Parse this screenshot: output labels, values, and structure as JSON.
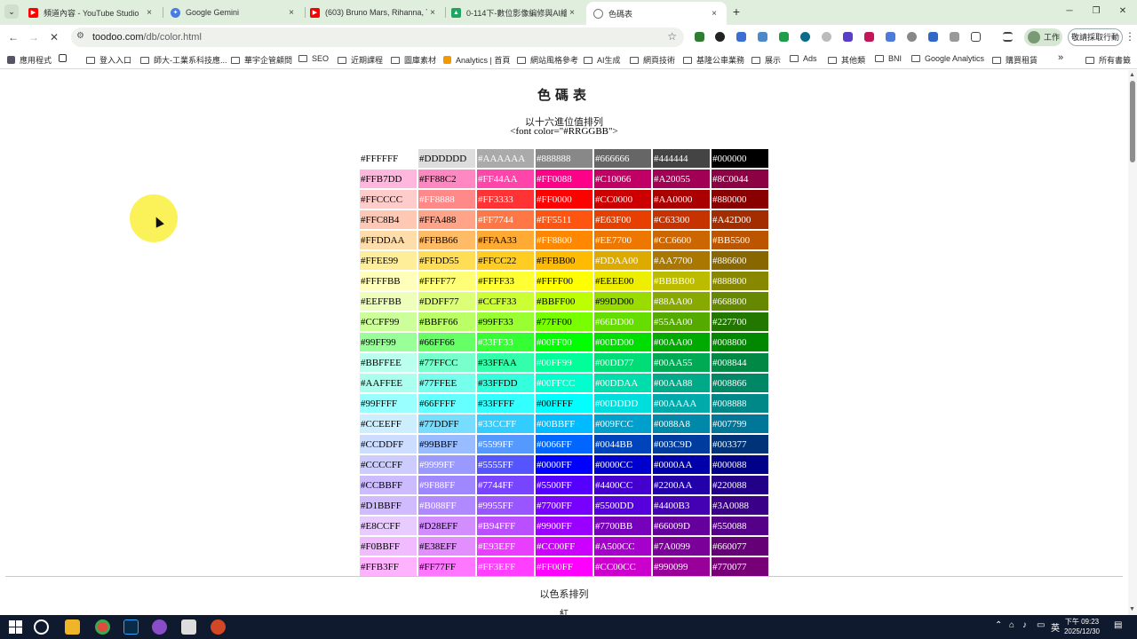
{
  "browser": {
    "tabs": [
      {
        "title": "頻道內容 - YouTube Studio",
        "icon": "youtube-icon",
        "color": "#ff0000",
        "active": false
      },
      {
        "title": "Google Gemini",
        "icon": "gemini-icon",
        "color": "#4a7be0",
        "active": false
      },
      {
        "title": "(603) Bruno Mars, Rihanna, Th",
        "icon": "youtube-icon",
        "color": "#ff0000",
        "active": false
      },
      {
        "title": "0-114下-數位影像編修與AI繪",
        "icon": "drive-icon",
        "color": "#1fa463",
        "active": false
      },
      {
        "title": "色碼表",
        "icon": "globe-icon",
        "color": "#777777",
        "active": true
      }
    ],
    "tab_close_glyph": "×",
    "new_tab_glyph": "+",
    "url_domain": "toodoo.com",
    "url_path": "/db/color.html",
    "profile_label": "工作",
    "action_label": "敬請採取行動",
    "bookmarks": [
      {
        "label": "應用程式",
        "icon": "apps-grid-icon"
      },
      {
        "label": "",
        "icon": "grid-icon"
      },
      {
        "label": "登入入口",
        "icon": "folder-icon"
      },
      {
        "label": "師大-工業系科技應...",
        "icon": "folder-icon"
      },
      {
        "label": "華宇企管顧問",
        "icon": "folder-icon"
      },
      {
        "label": "SEO",
        "icon": "folder-icon"
      },
      {
        "label": "近期課程",
        "icon": "folder-icon"
      },
      {
        "label": "圖庫素材",
        "icon": "folder-icon"
      },
      {
        "label": "Analytics | 首頁",
        "icon": "analytics-icon"
      },
      {
        "label": "網站風格參考",
        "icon": "folder-icon"
      },
      {
        "label": "AI生成",
        "icon": "folder-icon"
      },
      {
        "label": "網頁技術",
        "icon": "folder-icon"
      },
      {
        "label": "基隆公車業務",
        "icon": "folder-icon"
      },
      {
        "label": "展示",
        "icon": "folder-icon"
      },
      {
        "label": "Ads",
        "icon": "folder-icon"
      },
      {
        "label": "其他類",
        "icon": "folder-icon"
      },
      {
        "label": "BNI",
        "icon": "folder-icon"
      },
      {
        "label": "Google Analytics",
        "icon": "folder-icon"
      },
      {
        "label": "購買租賃",
        "icon": "folder-icon"
      }
    ],
    "bookmarks_more": "»",
    "all_bookmarks": "所有書籤"
  },
  "page": {
    "title": "色碼表",
    "subtitle": "以十六進位值排列",
    "code_hint": "<font color=\"#RRGGBB\">",
    "section2_label": "以色系排列",
    "section3_label": "紅"
  },
  "color_table": [
    [
      "#FFFFFF",
      "#DDDDDD",
      "#AAAAAA",
      "#888888",
      "#666666",
      "#444444",
      "#000000"
    ],
    [
      "#FFB7DD",
      "#FF88C2",
      "#FF44AA",
      "#FF0088",
      "#C10066",
      "#A20055",
      "#8C0044"
    ],
    [
      "#FFCCCC",
      "#FF8888",
      "#FF3333",
      "#FF0000",
      "#CC0000",
      "#AA0000",
      "#880000"
    ],
    [
      "#FFC8B4",
      "#FFA488",
      "#FF7744",
      "#FF5511",
      "#E63F00",
      "#C63300",
      "#A42D00"
    ],
    [
      "#FFDDAA",
      "#FFBB66",
      "#FFAA33",
      "#FF8800",
      "#EE7700",
      "#CC6600",
      "#BB5500"
    ],
    [
      "#FFEE99",
      "#FFDD55",
      "#FFCC22",
      "#FFBB00",
      "#DDAA00",
      "#AA7700",
      "#886600"
    ],
    [
      "#FFFFBB",
      "#FFFF77",
      "#FFFF33",
      "#FFFF00",
      "#EEEE00",
      "#BBBB00",
      "#888800"
    ],
    [
      "#EEFFBB",
      "#DDFF77",
      "#CCFF33",
      "#BBFF00",
      "#99DD00",
      "#88AA00",
      "#668800"
    ],
    [
      "#CCFF99",
      "#BBFF66",
      "#99FF33",
      "#77FF00",
      "#66DD00",
      "#55AA00",
      "#227700"
    ],
    [
      "#99FF99",
      "#66FF66",
      "#33FF33",
      "#00FF00",
      "#00DD00",
      "#00AA00",
      "#008800"
    ],
    [
      "#BBFFEE",
      "#77FFCC",
      "#33FFAA",
      "#00FF99",
      "#00DD77",
      "#00AA55",
      "#008844"
    ],
    [
      "#AAFFEE",
      "#77FFEE",
      "#33FFDD",
      "#00FFCC",
      "#00DDAA",
      "#00AA88",
      "#008866"
    ],
    [
      "#99FFFF",
      "#66FFFF",
      "#33FFFF",
      "#00FFFF",
      "#00DDDD",
      "#00AAAA",
      "#008888"
    ],
    [
      "#CCEEFF",
      "#77DDFF",
      "#33CCFF",
      "#00BBFF",
      "#009FCC",
      "#0088A8",
      "#007799"
    ],
    [
      "#CCDDFF",
      "#99BBFF",
      "#5599FF",
      "#0066FF",
      "#0044BB",
      "#003C9D",
      "#003377"
    ],
    [
      "#CCCCFF",
      "#9999FF",
      "#5555FF",
      "#0000FF",
      "#0000CC",
      "#0000AA",
      "#000088"
    ],
    [
      "#CCBBFF",
      "#9F88FF",
      "#7744FF",
      "#5500FF",
      "#4400CC",
      "#2200AA",
      "#220088"
    ],
    [
      "#D1BBFF",
      "#B088FF",
      "#9955FF",
      "#7700FF",
      "#5500DD",
      "#4400B3",
      "#3A0088"
    ],
    [
      "#E8CCFF",
      "#D28EFF",
      "#B94FFF",
      "#9900FF",
      "#7700BB",
      "#66009D",
      "#550088"
    ],
    [
      "#F0BBFF",
      "#E38EFF",
      "#E93EFF",
      "#CC00FF",
      "#A500CC",
      "#7A0099",
      "#660077"
    ],
    [
      "#FFB3FF",
      "#FF77FF",
      "#FF3EFF",
      "#FF00FF",
      "#CC00CC",
      "#990099",
      "#770077"
    ]
  ],
  "taskbar": {
    "time": "下午 09:23",
    "date": "2025/12/30",
    "ime": "英"
  }
}
